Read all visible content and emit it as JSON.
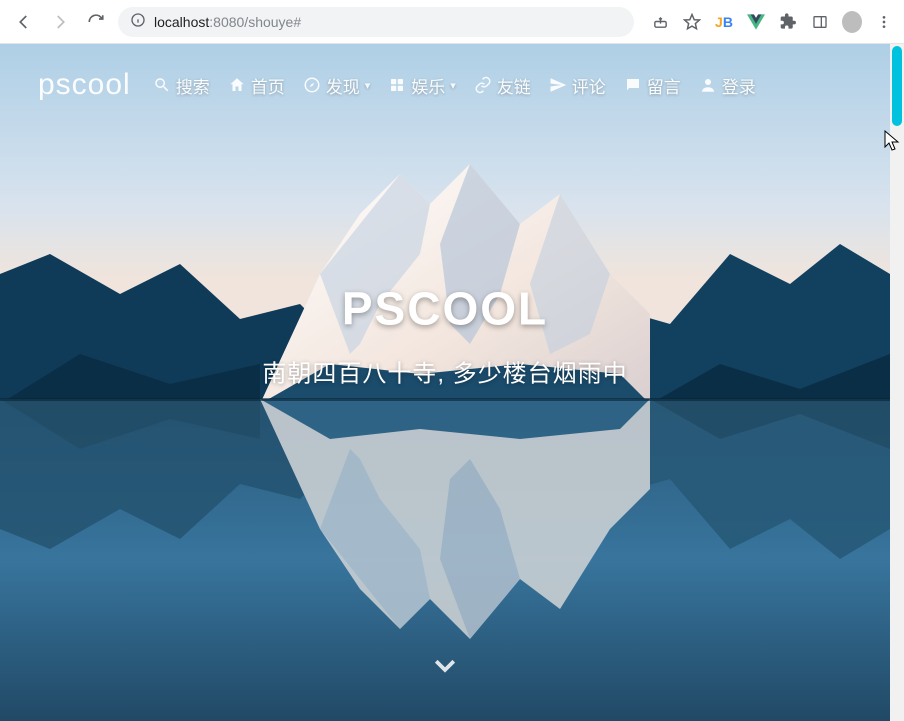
{
  "browser": {
    "url_host": "localhost",
    "url_port_path": ":8080/shouye#"
  },
  "nav": {
    "brand": "pscool",
    "search": "搜索",
    "home": "首页",
    "discover": "发现",
    "entertain": "娱乐",
    "links": "友链",
    "comments": "评论",
    "guestbook": "留言",
    "login": "登录"
  },
  "hero": {
    "title": "PSCOOL",
    "subtitle": "南朝四百八十寺, 多少楼台烟雨中"
  }
}
